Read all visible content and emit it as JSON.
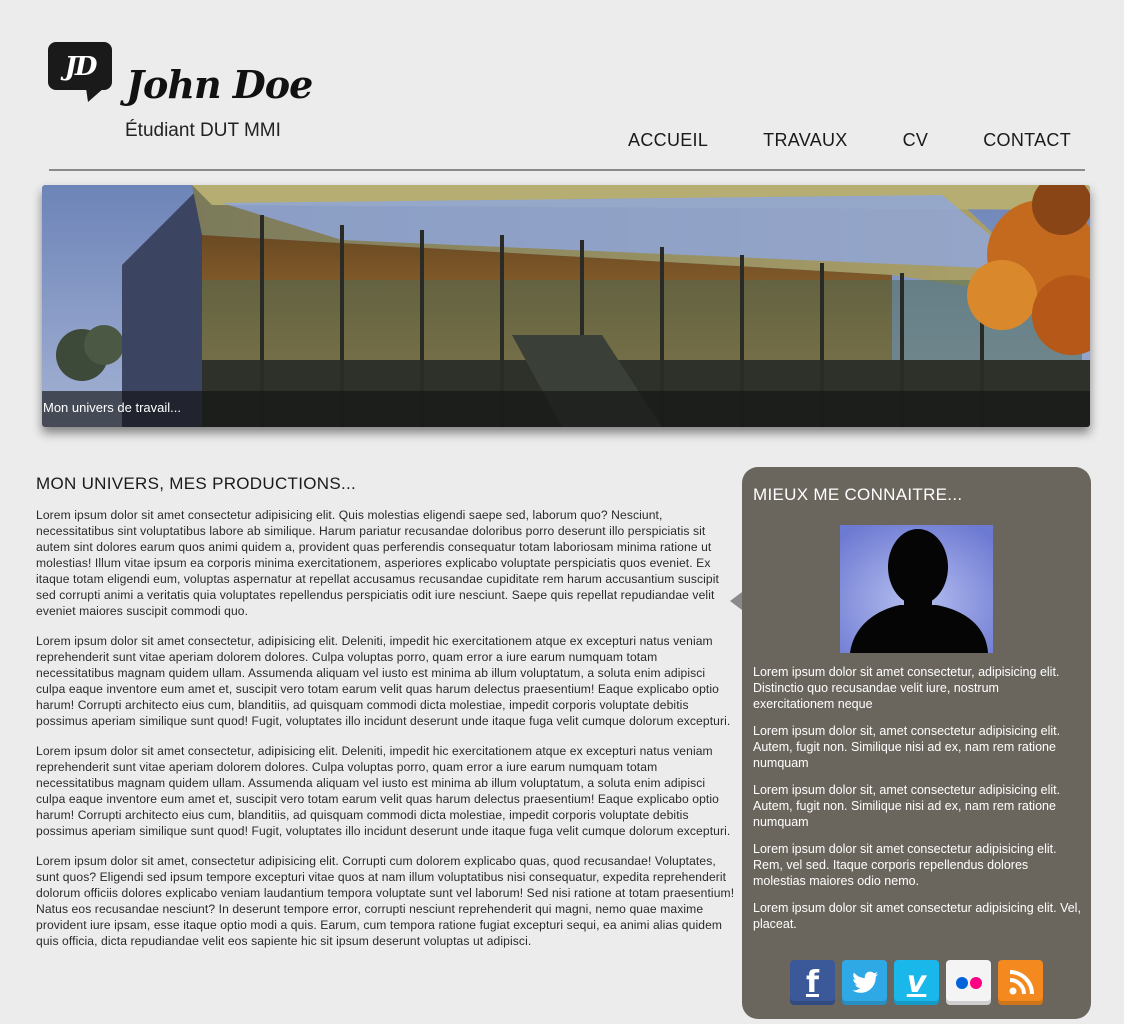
{
  "header": {
    "logo_text": "JD",
    "name": "John Doe",
    "subtitle": "Étudiant DUT MMI"
  },
  "nav": {
    "items": [
      {
        "label": "ACCUEIL"
      },
      {
        "label": "TRAVAUX"
      },
      {
        "label": "CV"
      },
      {
        "label": "CONTACT"
      }
    ]
  },
  "banner": {
    "caption": "Mon univers de travail..."
  },
  "main": {
    "title": "MON UNIVERS, MES PRODUCTIONS...",
    "paragraphs": [
      "Lorem ipsum dolor sit amet consectetur adipisicing elit. Quis molestias eligendi saepe sed, laborum quo? Nesciunt, necessitatibus sint voluptatibus labore ab similique. Harum pariatur recusandae doloribus porro deserunt illo perspiciatis sit autem sint dolores earum quos animi quidem a, provident quas perferendis consequatur totam laboriosam minima ratione ut molestias! Illum vitae ipsum ea corporis minima exercitationem, asperiores explicabo voluptate perspiciatis quos eveniet. Ex itaque totam eligendi eum, voluptas aspernatur at repellat accusamus recusandae cupiditate rem harum accusantium suscipit sed corrupti animi a veritatis quia voluptates repellendus perspiciatis odit iure nesciunt. Saepe quis repellat repudiandae velit eveniet maiores suscipit commodi quo.",
      "Lorem ipsum dolor sit amet consectetur, adipisicing elit. Deleniti, impedit hic exercitationem atque ex excepturi natus veniam reprehenderit sunt vitae aperiam dolorem dolores. Culpa voluptas porro, quam error a iure earum numquam totam necessitatibus magnam quidem ullam. Assumenda aliquam vel iusto est minima ab illum voluptatum, a soluta enim adipisci culpa eaque inventore eum amet et, suscipit vero totam earum velit quas harum delectus praesentium! Eaque explicabo optio harum! Corrupti architecto eius cum, blanditiis, ad quisquam commodi dicta molestiae, impedit corporis voluptate debitis possimus aperiam similique sunt quod! Fugit, voluptates illo incidunt deserunt unde itaque fuga velit cumque dolorum excepturi.",
      "Lorem ipsum dolor sit amet consectetur, adipisicing elit. Deleniti, impedit hic exercitationem atque ex excepturi natus veniam reprehenderit sunt vitae aperiam dolorem dolores. Culpa voluptas porro, quam error a iure earum numquam totam necessitatibus magnam quidem ullam. Assumenda aliquam vel iusto est minima ab illum voluptatum, a soluta enim adipisci culpa eaque inventore eum amet et, suscipit vero totam earum velit quas harum delectus praesentium! Eaque explicabo optio harum! Corrupti architecto eius cum, blanditiis, ad quisquam commodi dicta molestiae, impedit corporis voluptate debitis possimus aperiam similique sunt quod! Fugit, voluptates illo incidunt deserunt unde itaque fuga velit cumque dolorum excepturi.",
      "Lorem ipsum dolor sit amet, consectetur adipisicing elit. Corrupti cum dolorem explicabo quas, quod recusandae! Voluptates, sunt quos? Eligendi sed ipsum tempore excepturi vitae quos at nam illum voluptatibus nisi consequatur, expedita reprehenderit dolorum officiis dolores explicabo veniam laudantium tempora voluptate sunt vel laborum! Sed nisi ratione at totam praesentium! Natus eos recusandae nesciunt? In deserunt tempore error, corrupti nesciunt reprehenderit qui magni, nemo quae maxime provident iure ipsam, esse itaque optio modi a quis. Earum, cum tempora ratione fugiat excepturi sequi, ea animi alias quidem quis officia, dicta repudiandae velit eos sapiente hic sit ipsum deserunt voluptas ut adipisci."
    ]
  },
  "sidebar": {
    "title": "MIEUX ME CONNAITRE...",
    "paragraphs": [
      "Lorem ipsum dolor sit amet consectetur, adipisicing elit. Distinctio quo recusandae velit iure, nostrum exercitationem neque",
      "Lorem ipsum dolor sit, amet consectetur adipisicing elit. Autem, fugit non. Similique nisi ad ex, nam rem ratione numquam",
      "Lorem ipsum dolor sit, amet consectetur adipisicing elit. Autem, fugit non. Similique nisi ad ex, nam rem ratione numquam",
      "Lorem ipsum dolor sit amet consectetur adipisicing elit. Rem, vel sed. Itaque corporis repellendus dolores molestias maiores odio nemo.",
      "Lorem ipsum dolor sit amet consectetur adipisicing elit. Vel, placeat."
    ],
    "socials": [
      {
        "icon": "facebook-icon",
        "glyph": "f",
        "color": "#3b5998"
      },
      {
        "icon": "twitter-icon",
        "glyph": "t",
        "color": "#2fa8e6"
      },
      {
        "icon": "vimeo-icon",
        "glyph": "v",
        "color": "#1ab7ea"
      },
      {
        "icon": "flickr-icon",
        "glyph": "●●",
        "color": "#f4f4f4"
      },
      {
        "icon": "rss-icon",
        "glyph": ")",
        "color": "#f48a1f"
      }
    ]
  },
  "colors": {
    "sidebar_bg": "#6b665d",
    "page_bg": "#ececec"
  }
}
